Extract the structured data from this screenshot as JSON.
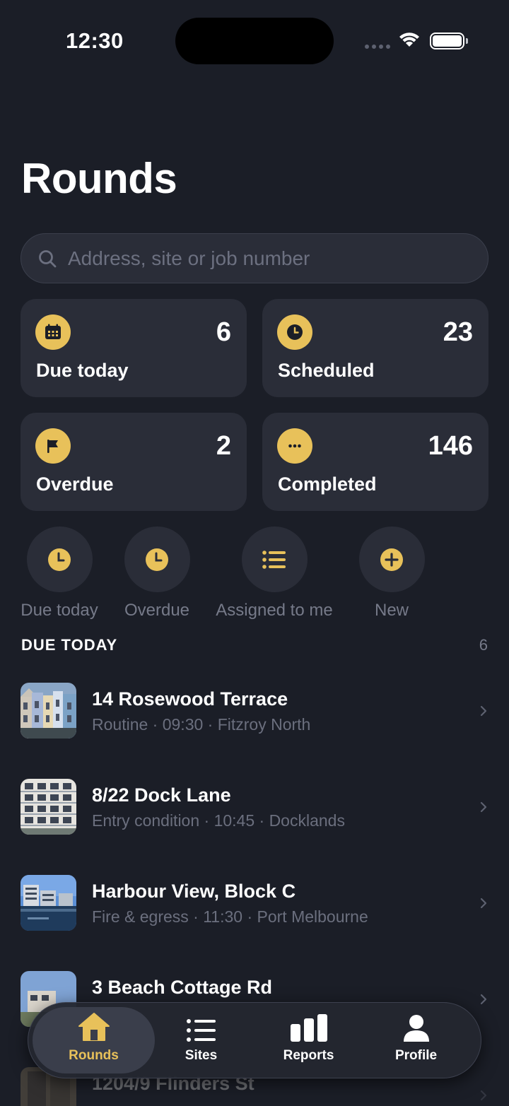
{
  "status": {
    "time": "12:30"
  },
  "title": "Rounds",
  "search": {
    "placeholder": "Address, site or job number",
    "value": ""
  },
  "colors": {
    "accent": "#e8c15a",
    "background": "#1b1e27",
    "card": "#2a2d38"
  },
  "stats": [
    {
      "label": "Due today",
      "count": "6",
      "icon": "calendar-icon"
    },
    {
      "label": "Scheduled",
      "count": "23",
      "icon": "clock-icon"
    },
    {
      "label": "Overdue",
      "count": "2",
      "icon": "flag-icon"
    },
    {
      "label": "Completed",
      "count": "146",
      "icon": "ellipsis-icon"
    }
  ],
  "quick_filters": [
    {
      "label": "Due today",
      "icon": "clock-icon"
    },
    {
      "label": "Overdue",
      "icon": "clock-icon"
    },
    {
      "label": "Assigned to me",
      "icon": "list-icon"
    },
    {
      "label": "New",
      "icon": "plus-icon"
    }
  ],
  "section": {
    "title": "DUE TODAY",
    "count": "6"
  },
  "rounds": [
    {
      "title": "14 Rosewood Terrace",
      "subtitle": "Routine · 09:30 · Fitzroy North"
    },
    {
      "title": "8/22 Dock Lane",
      "subtitle": "Entry condition · 10:45 · Docklands"
    },
    {
      "title": "Harbour View, Block C",
      "subtitle": "Fire & egress · 11:30 · Port Melbourne"
    },
    {
      "title": "3 Beach Cottage Rd",
      "subtitle": ""
    },
    {
      "title": "1204/9 Flinders St",
      "subtitle": ""
    }
  ],
  "tabs": [
    {
      "label": "Rounds",
      "icon": "house-icon",
      "active": true
    },
    {
      "label": "Sites",
      "icon": "list-icon",
      "active": false
    },
    {
      "label": "Reports",
      "icon": "bar-chart-icon",
      "active": false
    },
    {
      "label": "Profile",
      "icon": "person-icon",
      "active": false
    }
  ]
}
